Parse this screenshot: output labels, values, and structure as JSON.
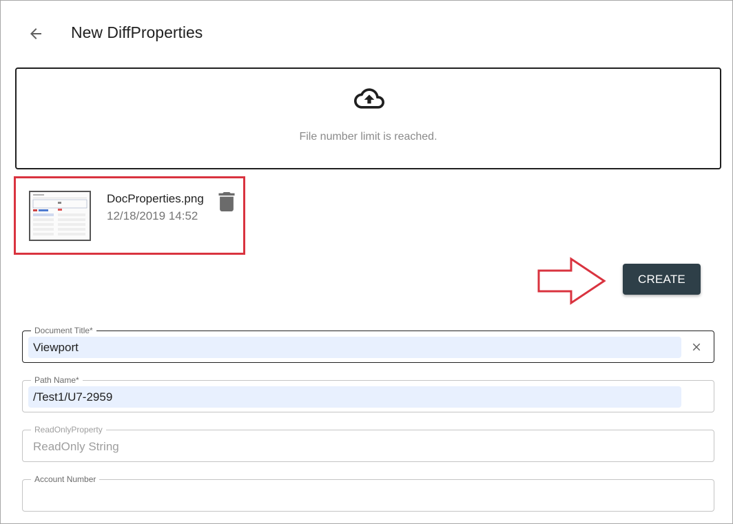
{
  "header": {
    "title": "New DiffProperties",
    "back_icon": "arrow-left-icon"
  },
  "dropzone": {
    "icon": "cloud-upload-icon",
    "message": "File number limit is reached."
  },
  "file": {
    "name": "DocProperties.png",
    "date": "12/18/2019 14:52",
    "delete_icon": "trash-icon",
    "highlight_color": "#d9333f"
  },
  "actions": {
    "create_label": "CREATE",
    "create_color": "#2e3f48"
  },
  "form": {
    "fields": [
      {
        "label": "Document Title",
        "value": "Viewport"
      },
      {
        "label": "Path Name",
        "value": "/Test1/U7-2959"
      },
      {
        "label": "ReadOnlyProperty",
        "value": "ReadOnly String"
      },
      {
        "label": "Account Number",
        "value": ""
      }
    ],
    "required_mark": "*"
  }
}
